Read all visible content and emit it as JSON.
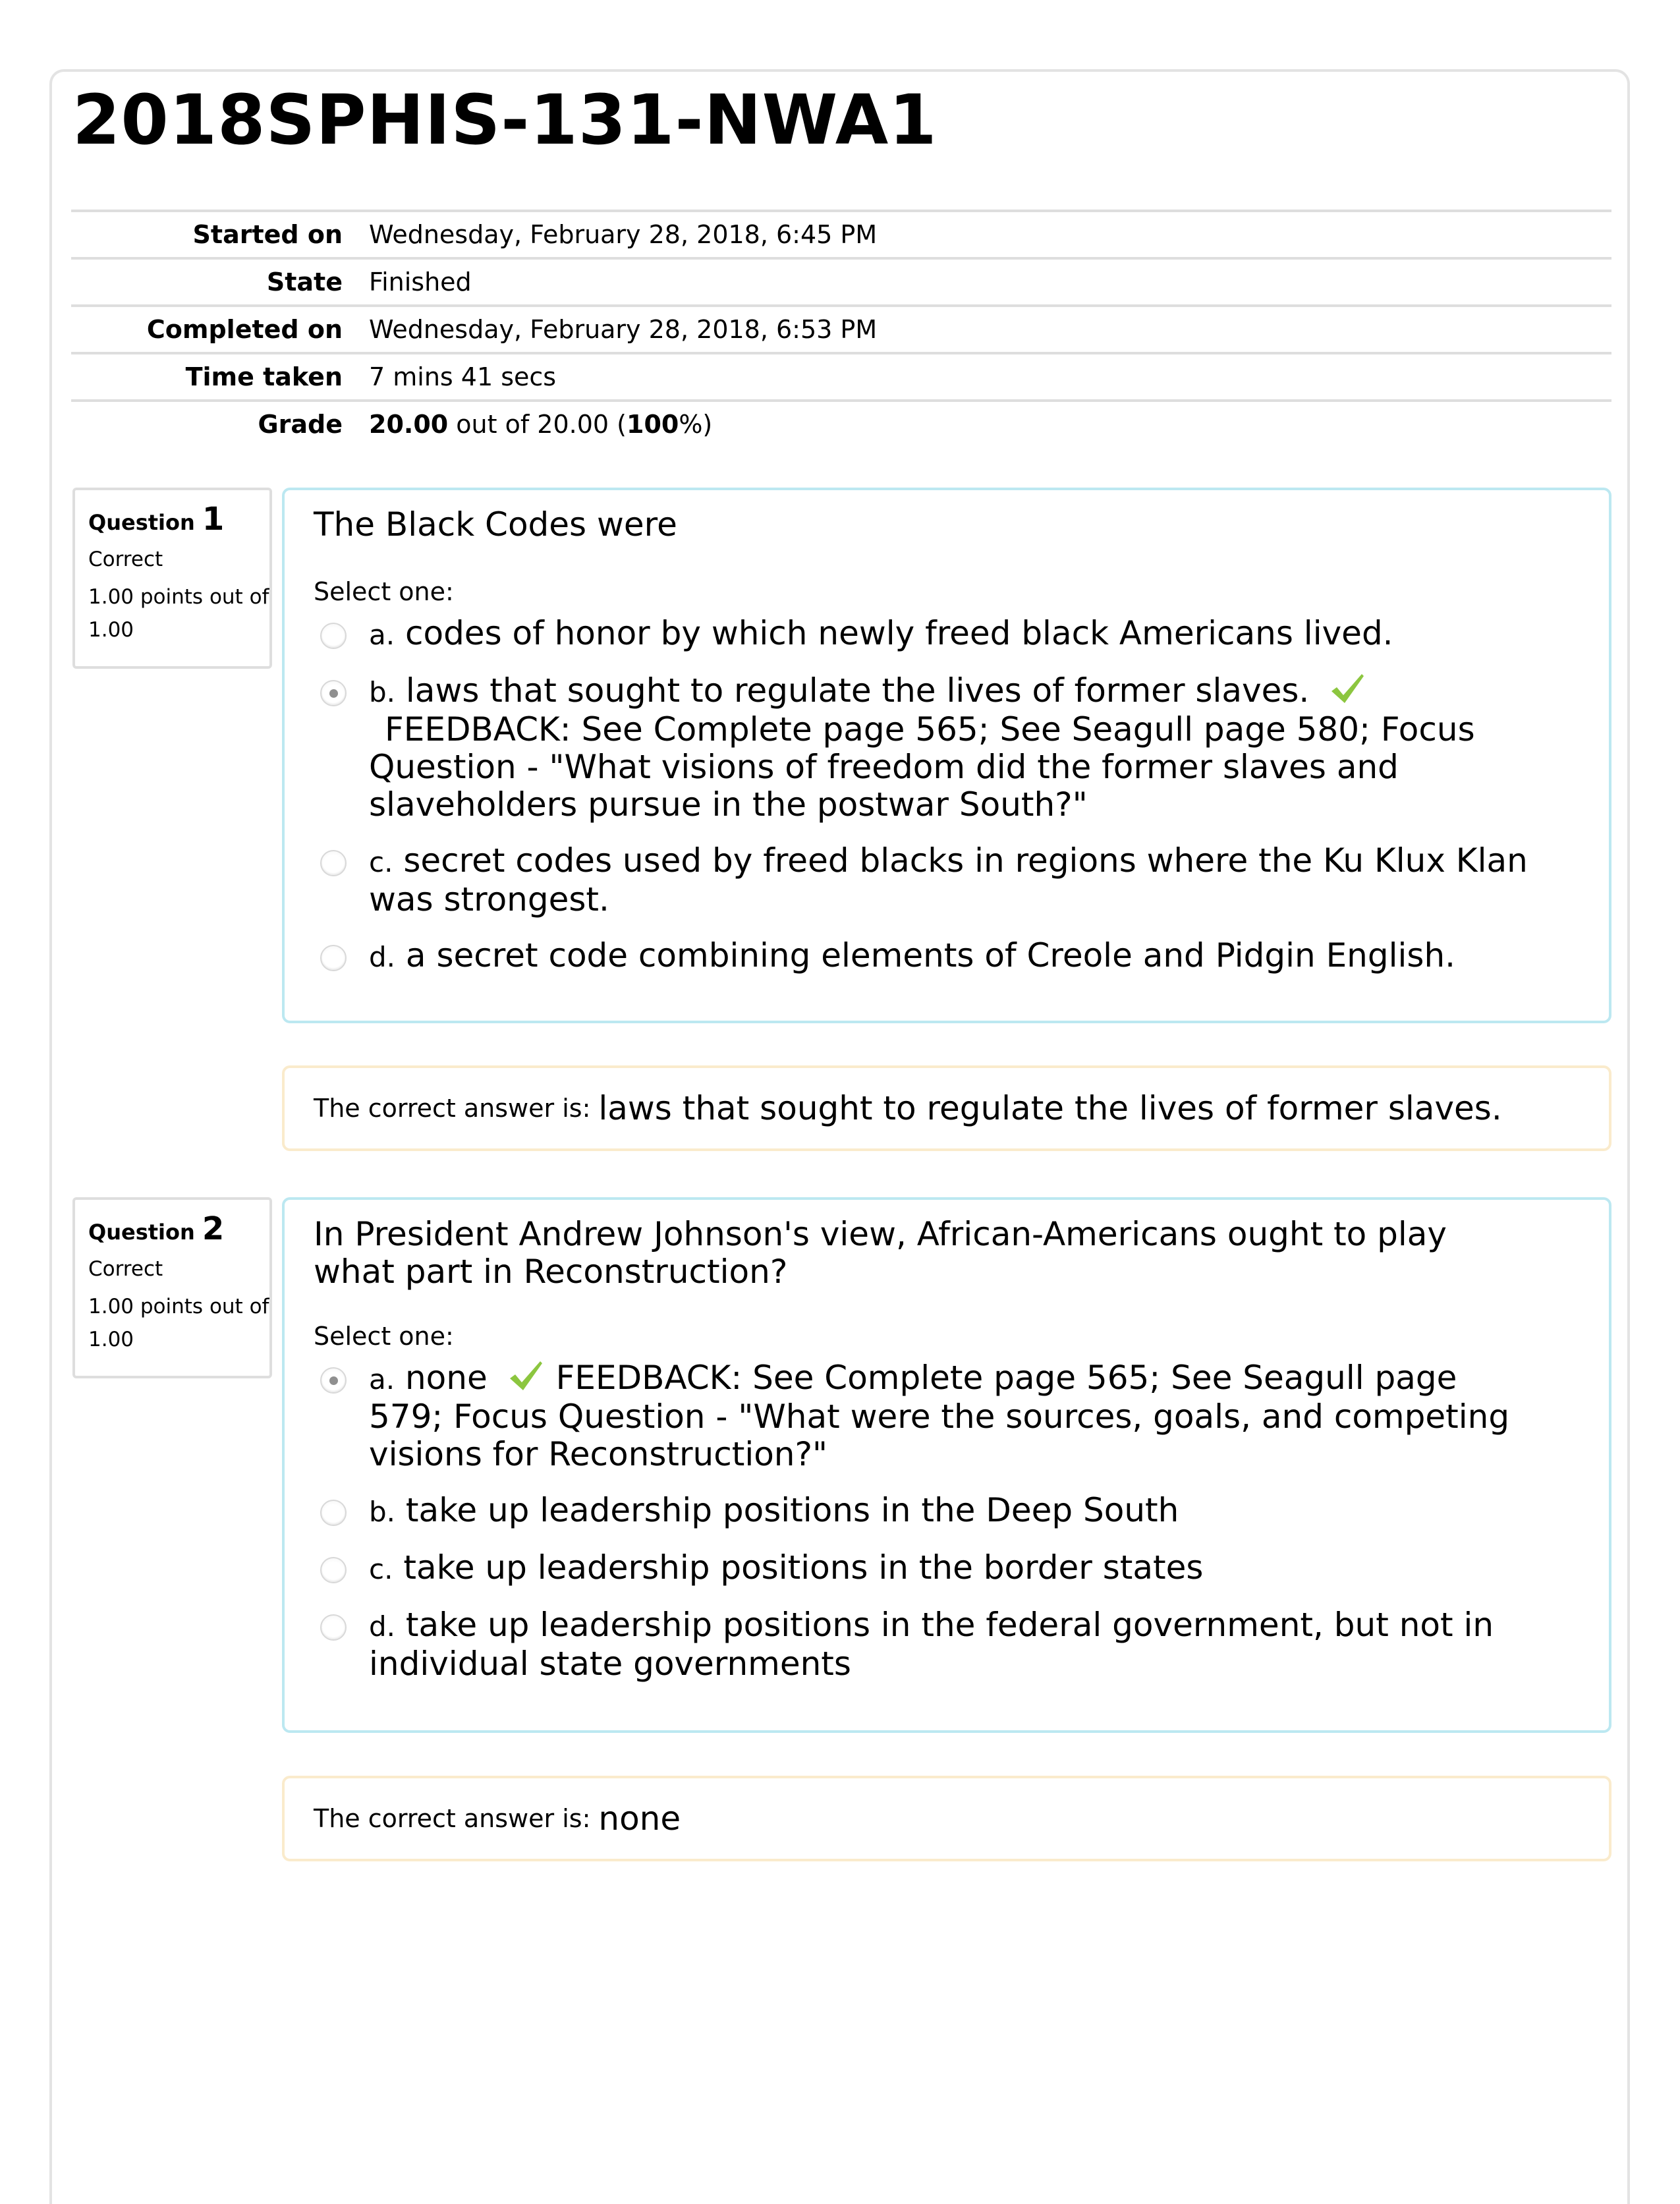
{
  "page": {
    "title": "2018SPHIS-131-NWA1"
  },
  "summary": {
    "rows": [
      {
        "label": "Started on",
        "value": "Wednesday, February 28, 2018, 6:45 PM"
      },
      {
        "label": "State",
        "value": "Finished"
      },
      {
        "label": "Completed on",
        "value": "Wednesday, February 28, 2018, 6:53 PM"
      },
      {
        "label": "Time taken",
        "value": "7 mins 41 secs"
      }
    ],
    "grade": {
      "label": "Grade",
      "score": "20.00",
      "out_of_text": " out of 20.00 (",
      "percent": "100",
      "percent_suffix": "%)"
    }
  },
  "colors": {
    "question_border": "#bce8f1",
    "answer_border": "#faebcc",
    "info_border": "#dedede",
    "check_green": "#8cc63f"
  },
  "questions": [
    {
      "label": "Question",
      "number": "1",
      "state": "Correct",
      "grade": "1.00 points out of 1.00",
      "text": "The Black Codes were",
      "prompt": "Select one:",
      "options": [
        {
          "letter": "a.",
          "text": " codes of honor by which newly freed black Americans lived.",
          "selected": false,
          "feedback": ""
        },
        {
          "letter": "b.",
          "text": " laws that sought to regulate the lives of former slaves.",
          "selected": true,
          "correct": true,
          "feedback": "FEEDBACK: See Complete page 565; See Seagull page 580; Focus Question - \"What visions of freedom did the former slaves and slaveholders pursue in the postwar South?\""
        },
        {
          "letter": "c.",
          "text": " secret codes used by freed blacks in regions where the Ku Klux Klan was strongest.",
          "selected": false,
          "feedback": ""
        },
        {
          "letter": "d.",
          "text": " a secret code combining elements of Creole and Pidgin English.",
          "selected": false,
          "feedback": ""
        }
      ],
      "right_answer_lead": "The correct answer is:",
      "right_answer": "laws that sought to regulate the lives of former slaves."
    },
    {
      "label": "Question",
      "number": "2",
      "state": "Correct",
      "grade": "1.00 points out of 1.00",
      "text": "In President Andrew Johnson's view, African-Americans ought to play what part in Reconstruction?",
      "prompt": "Select one:",
      "options": [
        {
          "letter": "a.",
          "text": " none",
          "selected": true,
          "correct": true,
          "feedback": "FEEDBACK: See Complete page 565; See Seagull page 579; Focus Question - \"What were the sources, goals, and competing visions for Reconstruction?\""
        },
        {
          "letter": "b.",
          "text": " take up leadership positions in the Deep South",
          "selected": false,
          "feedback": ""
        },
        {
          "letter": "c.",
          "text": " take up leadership positions in the border states",
          "selected": false,
          "feedback": ""
        },
        {
          "letter": "d.",
          "text": " take up leadership positions in the federal government, but not in individual state governments",
          "selected": false,
          "feedback": ""
        }
      ],
      "right_answer_lead": "The correct answer is:",
      "right_answer": "none"
    }
  ]
}
